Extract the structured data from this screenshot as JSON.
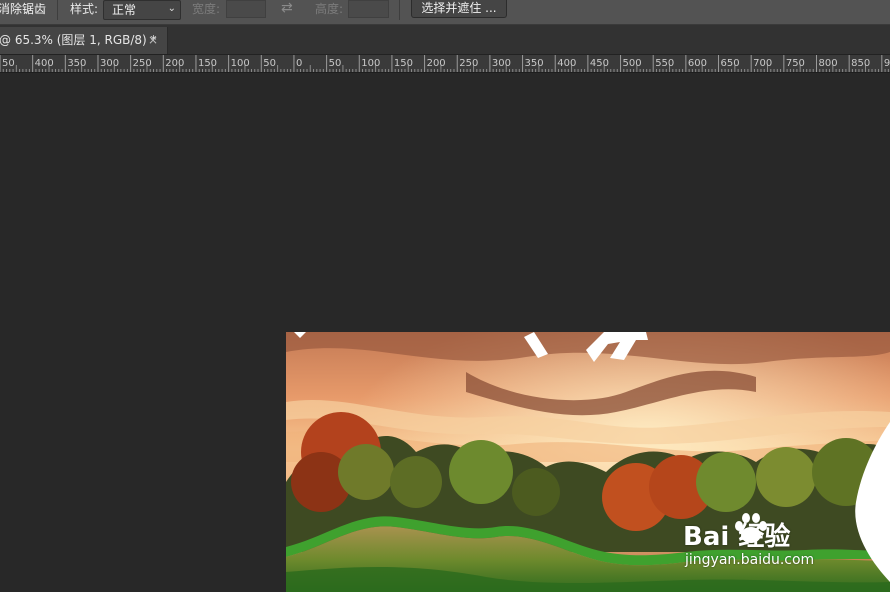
{
  "options_bar": {
    "antialias_label": "消除锯齿",
    "style_label": "样式:",
    "style_value": "正常",
    "width_label": "宽度:",
    "height_label": "高度:",
    "select_mask_label": "选择并遮住 ..."
  },
  "tab": {
    "title": "@ 65.3% (图层 1, RGB/8) *",
    "close_glyph": "×"
  },
  "ruler": {
    "labels": [
      "50",
      "400",
      "350",
      "300",
      "250",
      "200",
      "150",
      "100",
      "50",
      "0",
      "50",
      "100",
      "150",
      "200",
      "250",
      "300",
      "350",
      "400",
      "450",
      "500",
      "550",
      "600",
      "650",
      "700",
      "750",
      "800",
      "850",
      "90"
    ]
  },
  "watermark": {
    "brand": "Bai  经验",
    "url": "jingyan.baidu.com"
  },
  "colors": {
    "workspace": "#282828",
    "options_bar": "#535353",
    "tab_active": "#454545",
    "ruler": "#3a3a3a"
  }
}
